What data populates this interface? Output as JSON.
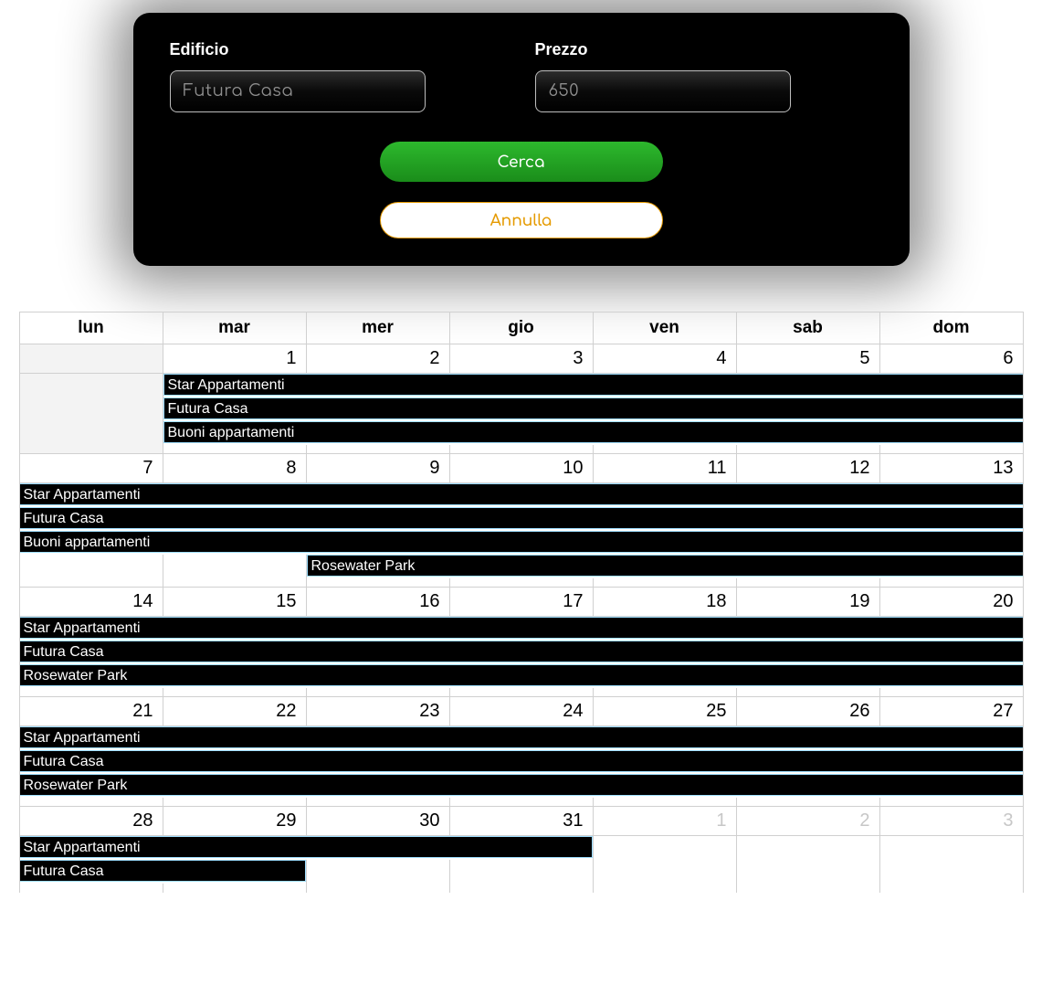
{
  "form": {
    "building_label": "Edificio",
    "building_placeholder": "Futura Casa",
    "price_label": "Prezzo",
    "price_placeholder": "650",
    "search_label": "Cerca",
    "cancel_label": "Annulla"
  },
  "calendar": {
    "days": [
      "lun",
      "mar",
      "mer",
      "gio",
      "ven",
      "sab",
      "dom"
    ],
    "weeks": [
      {
        "nums": [
          "",
          "1",
          "2",
          "3",
          "4",
          "5",
          "6"
        ],
        "other": [
          true,
          false,
          false,
          false,
          false,
          false,
          false
        ],
        "events": [
          {
            "label": "Star Appartamenti",
            "start": 1,
            "end": 7
          },
          {
            "label": "Futura Casa",
            "start": 1,
            "end": 7
          },
          {
            "label": "Buoni appartamenti",
            "start": 1,
            "end": 7
          }
        ]
      },
      {
        "nums": [
          "7",
          "8",
          "9",
          "10",
          "11",
          "12",
          "13"
        ],
        "other": [
          false,
          false,
          false,
          false,
          false,
          false,
          false
        ],
        "events": [
          {
            "label": "Star Appartamenti",
            "start": 0,
            "end": 7
          },
          {
            "label": "Futura Casa",
            "start": 0,
            "end": 7
          },
          {
            "label": "Buoni appartamenti",
            "start": 0,
            "end": 7
          },
          {
            "label": "Rosewater Park",
            "start": 2,
            "end": 7
          }
        ]
      },
      {
        "nums": [
          "14",
          "15",
          "16",
          "17",
          "18",
          "19",
          "20"
        ],
        "other": [
          false,
          false,
          false,
          false,
          false,
          false,
          false
        ],
        "events": [
          {
            "label": "Star Appartamenti",
            "start": 0,
            "end": 7
          },
          {
            "label": "Futura Casa",
            "start": 0,
            "end": 7
          },
          {
            "label": "Rosewater Park",
            "start": 0,
            "end": 7
          }
        ]
      },
      {
        "nums": [
          "21",
          "22",
          "23",
          "24",
          "25",
          "26",
          "27"
        ],
        "other": [
          false,
          false,
          false,
          false,
          false,
          false,
          false
        ],
        "events": [
          {
            "label": "Star Appartamenti",
            "start": 0,
            "end": 7
          },
          {
            "label": "Futura Casa",
            "start": 0,
            "end": 7
          },
          {
            "label": "Rosewater Park",
            "start": 0,
            "end": 7
          }
        ]
      },
      {
        "nums": [
          "28",
          "29",
          "30",
          "31",
          "1",
          "2",
          "3"
        ],
        "other": [
          false,
          false,
          false,
          false,
          true,
          true,
          true
        ],
        "events": [
          {
            "label": "Star Appartamenti",
            "start": 0,
            "end": 4
          },
          {
            "label": "Futura Casa",
            "start": 0,
            "end": 2
          }
        ]
      }
    ]
  }
}
